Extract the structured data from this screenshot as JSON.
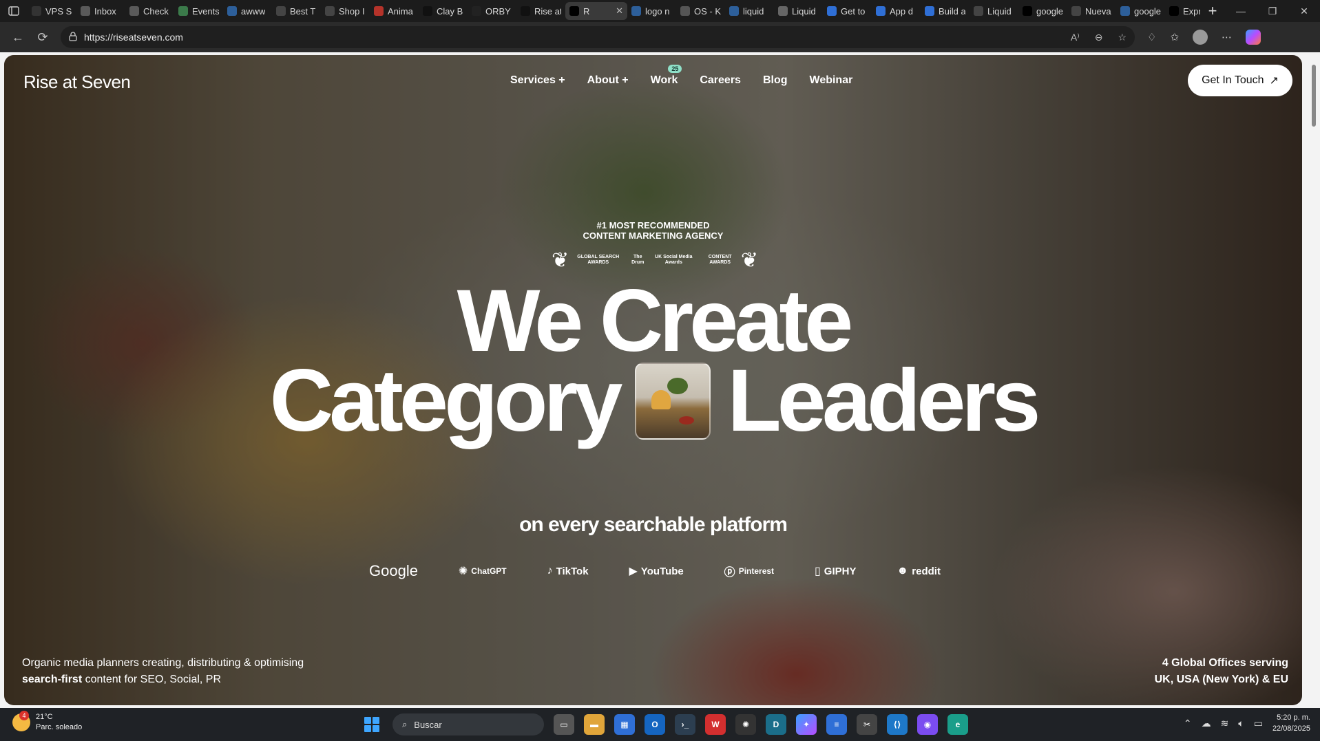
{
  "browser": {
    "tabs": [
      {
        "label": "VPS Sr",
        "icon": "vps-icon",
        "color": "#333333"
      },
      {
        "label": "Inbox",
        "icon": "gmail-icon",
        "color": "#5a5a5a"
      },
      {
        "label": "Check",
        "icon": "gmail-icon",
        "color": "#5a5a5a"
      },
      {
        "label": "Events",
        "icon": "events-icon",
        "color": "#3b7a4a"
      },
      {
        "label": "awww",
        "icon": "search-icon",
        "color": "#2d5f9a"
      },
      {
        "label": "Best T",
        "icon": "w-icon",
        "color": "#444444"
      },
      {
        "label": "Shop I",
        "icon": "w-icon",
        "color": "#444444"
      },
      {
        "label": "Anima",
        "icon": "anima-icon",
        "color": "#b5332a"
      },
      {
        "label": "Clay B",
        "icon": "w-icon",
        "color": "#111111"
      },
      {
        "label": "ORBY",
        "icon": "orby-icon",
        "color": "#222222"
      },
      {
        "label": "Rise at",
        "icon": "w-icon",
        "color": "#111111"
      },
      {
        "label": "R",
        "icon": "n-icon",
        "color": "#000000",
        "active": true
      },
      {
        "label": "logo n",
        "icon": "search-icon",
        "color": "#2d5f9a"
      },
      {
        "label": "OS - K",
        "icon": "os-icon",
        "color": "#555555"
      },
      {
        "label": "liquid",
        "icon": "search-icon",
        "color": "#2d5f9a"
      },
      {
        "label": "Liquid",
        "icon": "liquid-icon",
        "color": "#666666"
      },
      {
        "label": "Get to",
        "icon": "get-icon",
        "color": "#2f6fd6"
      },
      {
        "label": "App d",
        "icon": "app-icon",
        "color": "#2f6fd6"
      },
      {
        "label": "Build a",
        "icon": "build-icon",
        "color": "#2f6fd6"
      },
      {
        "label": "Liquid",
        "icon": "globe-icon",
        "color": "#444444"
      },
      {
        "label": "google",
        "icon": "github-icon",
        "color": "#000000"
      },
      {
        "label": "Nueva",
        "icon": "newtab-icon",
        "color": "#444444"
      },
      {
        "label": "google",
        "icon": "search-icon",
        "color": "#2d5f9a"
      },
      {
        "label": "Expres",
        "icon": "g-icon",
        "color": "#000000"
      }
    ],
    "url": "https://riseatseven.com"
  },
  "site": {
    "logo": "Rise at Seven",
    "nav": [
      {
        "label": "Services +"
      },
      {
        "label": "About +"
      },
      {
        "label": "Work",
        "badge": "25"
      },
      {
        "label": "Careers"
      },
      {
        "label": "Blog"
      },
      {
        "label": "Webinar"
      }
    ],
    "cta": "Get In Touch",
    "award_line1": "#1 MOST RECOMMENDED",
    "award_line2": "CONTENT MARKETING AGENCY",
    "award_logos": [
      "GLOBAL SEARCH AWARDS",
      "The Drum",
      "UK Social Media Awards",
      "CONTENT AWARDS"
    ],
    "headline_line1": "We Create",
    "headline_line2a": "Category",
    "headline_line2b": "Leaders",
    "subheadline": "on every searchable platform",
    "platforms": [
      "Google",
      "ChatGPT",
      "TikTok",
      "YouTube",
      "Pinterest",
      "GIPHY",
      "reddit"
    ],
    "footer_left_line1": "Organic media planners creating, distributing & optimising",
    "footer_left_bold": "search-first",
    "footer_left_line2": " content for SEO, Social, PR",
    "footer_right_line1": "4 Global Offices serving",
    "footer_right_line2": "UK, USA (New York) & EU"
  },
  "taskbar": {
    "temperature": "21°C",
    "weather": "Parc. soleado",
    "weather_badge": "4",
    "search_placeholder": "Buscar",
    "time": "5:20 p. m.",
    "date": "22/08/2025"
  }
}
